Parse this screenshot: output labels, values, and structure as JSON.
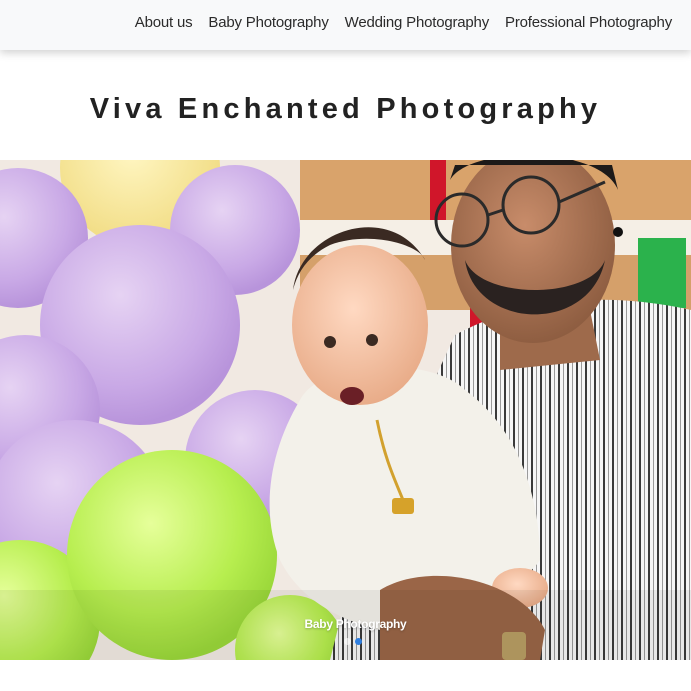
{
  "nav": {
    "items": [
      {
        "label": "About us"
      },
      {
        "label": "Baby Photography"
      },
      {
        "label": "Wedding Photography"
      },
      {
        "label": "Professional Photography"
      }
    ]
  },
  "site": {
    "title": "Viva Enchanted Photography"
  },
  "slider": {
    "caption": "Baby Photography",
    "active_index": 1,
    "dot_count": 2
  },
  "colors": {
    "nav_background": "#f8f9fa",
    "title_text": "#222222",
    "active_dot": "#2f7fe0"
  }
}
